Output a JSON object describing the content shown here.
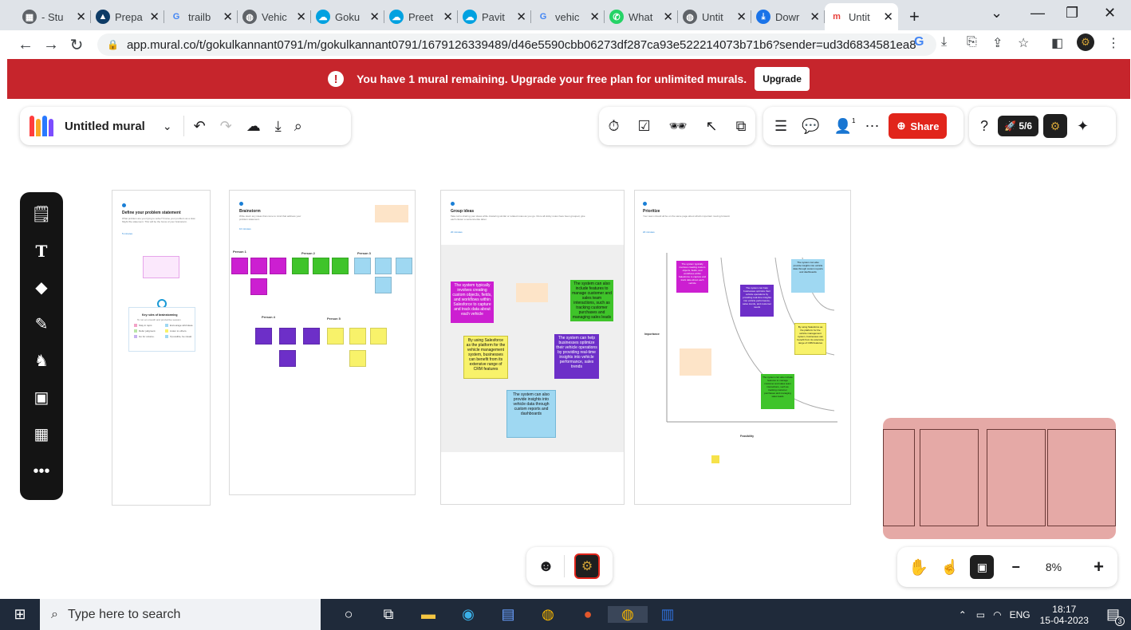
{
  "browser": {
    "tabs": [
      {
        "title": "- Stu",
        "fav": "doc-icon",
        "color": "#5f6368"
      },
      {
        "title": "Prepa",
        "fav": "mountain-icon",
        "color": "#0d3b66"
      },
      {
        "title": "trailb",
        "fav": "google-icon",
        "color": "#4285f4"
      },
      {
        "title": "Vehic",
        "fav": "globe-icon",
        "color": "#5f6368"
      },
      {
        "title": "Goku",
        "fav": "salesforce-icon",
        "color": "#00a1e0"
      },
      {
        "title": "Preet",
        "fav": "salesforce-icon",
        "color": "#00a1e0"
      },
      {
        "title": "Pavit",
        "fav": "salesforce-icon",
        "color": "#00a1e0"
      },
      {
        "title": "vehic",
        "fav": "google-icon",
        "color": "#4285f4"
      },
      {
        "title": "What",
        "fav": "whatsapp-icon",
        "color": "#25d366"
      },
      {
        "title": "Untit",
        "fav": "globe-icon",
        "color": "#5f6368"
      },
      {
        "title": "Dowr",
        "fav": "download-icon",
        "color": "#1a73e8"
      },
      {
        "title": "Untit",
        "fav": "mural-icon",
        "color": "#e8413c",
        "active": true
      }
    ],
    "new_tab": "+",
    "url": "app.mural.co/t/gokulkannant0791/m/gokulkannant0791/1679126339489/d46e5590cbb06273df287ca93e522214073b71b6?sender=ud3d6834581ea8db..."
  },
  "banner": {
    "text": "You have 1 mural remaining. Upgrade your free plan for unlimited murals.",
    "upgrade": "Upgrade",
    "color": "#c6252c"
  },
  "mural": {
    "title": "Untitled mural",
    "share": "Share",
    "progress": "5/6",
    "collab_count": "1",
    "zoom": "8%"
  },
  "boards": {
    "b1": {
      "title": "Define your problem statement",
      "desc": "What problem are you trying to solve? Frame your problem as a How Might We statement. This will be the focus of your brainstorm.",
      "link": "5 minutes",
      "tip_title": "Key rules of brainstorming",
      "tip_desc": "To run an smooth and productive session",
      "rules": [
        "Stay in topic.",
        "Encourage wild ideas.",
        "Defer judgment.",
        "Listen to others.",
        "Go for volume.",
        "If possible, be visual."
      ]
    },
    "b2": {
      "title": "Brainstorm",
      "desc": "Write down any ideas that come to mind that address your problem statement.",
      "link": "10 minutes",
      "persons": [
        "Person 1",
        "Person 2",
        "Person 3",
        "Person 4",
        "Person 5"
      ]
    },
    "b3": {
      "title": "Group ideas",
      "desc": "Take turns sharing your ideas while clustering similar or related notes as you go. Once all sticky notes have been grouped, give each cluster a sentence-like label.",
      "link": "20 minutes",
      "notes": [
        "The system typically involves creating custom objects, fields, and workflows within Salesforce to capture and track data about each vehicle",
        "The system can also include features to manage customer and sales team interactions, such as tracking customer purchases and managing sales leads",
        "By using Salesforce as the platform for the vehicle management system, businesses can benefit from its extensive range of CRM features",
        "The system can help businesses optimize their vehicle operations by providing real-time insights into vehicle performance, sales trends",
        "The system can also provide insights into vehicle data through custom reports and dashboards"
      ]
    },
    "b4": {
      "title": "Prioritize",
      "desc": "Your team should all be on the same page about what's important moving forward.",
      "link": "20 minutes",
      "axis_y": "Importance",
      "axis_x": "Feasibility",
      "notes": [
        "The system typically involves creating custom objects, fields, and workflows within Salesforce to capture and track data about each vehicle",
        "The system can help businesses optimize their vehicle operations by providing real-time insights into vehicle performance, sales trends, and customer needs",
        "The system can also provide insights into vehicle data through custom reports and dashboards",
        "By using Salesforce as the platform for the vehicle management system, businesses can benefit from its extensive range of CRM features",
        "The system can also include features to manage customer and sales team interactions, such as tracking customer purchases and managing sales leads"
      ]
    }
  },
  "colors": {
    "magenta": "#cc1fd1",
    "green": "#3fc42a",
    "purple": "#6d2fc8",
    "yellow": "#f8f26a",
    "blue": "#9fd8f2",
    "peach": "#fde4c8"
  },
  "taskbar": {
    "search": "Type here to search",
    "lang": "ENG",
    "time": "18:17",
    "date": "15-04-2023",
    "notif": "3"
  }
}
